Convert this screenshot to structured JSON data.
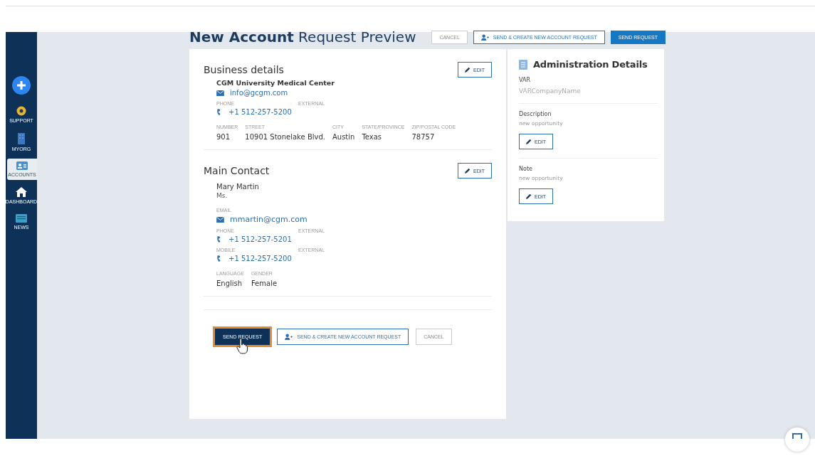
{
  "sidebar": {
    "items": [
      {
        "kind": "support",
        "label": "SUPPORT",
        "selected": false
      },
      {
        "kind": "org",
        "label": "MYORG",
        "selected": false
      },
      {
        "kind": "accounts",
        "label": "ACCOUNTS",
        "selected": true
      },
      {
        "kind": "home",
        "label": "DASHBOARD",
        "selected": false
      },
      {
        "kind": "news",
        "label": "NEWS",
        "selected": false
      }
    ]
  },
  "page": {
    "title_bold": "New Account",
    "title_rest": "Request Preview"
  },
  "top_actions": [
    {
      "kind": "plain",
      "label": "CANCEL"
    },
    {
      "kind": "outline",
      "label": "SEND & CREATE NEW ACCOUNT REQUEST"
    },
    {
      "kind": "primary",
      "label": "SEND REQUEST"
    }
  ],
  "business": {
    "heading": "Business details",
    "edit": "EDIT",
    "name": "CGM University Medical Center",
    "email": "info@gcgm.com",
    "phone_label": "PHONE",
    "external_label": "EXTERNAL",
    "phone": "+1 512-257-5200",
    "address": [
      {
        "label": "NUMBER",
        "value": "901"
      },
      {
        "label": "STREET",
        "value": "10901 Stonelake Blvd."
      },
      {
        "label": "CITY",
        "value": "Austin"
      },
      {
        "label": "STATE/PROVINCE",
        "value": "Texas"
      },
      {
        "label": "ZIP/POSTAL CODE",
        "value": "78757"
      }
    ]
  },
  "contact": {
    "heading": "Main Contact",
    "edit": "EDIT",
    "name": "Mary Martin",
    "salutation": "Ms.",
    "email_label": "EMAIL",
    "email": "mmartin@cgm.com",
    "phones": [
      {
        "label": "PHONE",
        "external_label": "EXTERNAL",
        "value": "+1 512-257-5201"
      },
      {
        "label": "MOBILE",
        "external_label": "EXTERNAL",
        "value": "+1 512-257-5200"
      }
    ],
    "extra": [
      {
        "label": "LANGUAGE",
        "value": "English"
      },
      {
        "label": "GENDER",
        "value": "Female"
      }
    ]
  },
  "bottom_actions": [
    {
      "kind": "primary",
      "label": "SEND REQUEST",
      "focused": true
    },
    {
      "kind": "outline",
      "label": "SEND & CREATE NEW ACCOUNT REQUEST",
      "focused": false
    },
    {
      "kind": "plain",
      "label": "CANCEL",
      "focused": false
    }
  ],
  "admin": {
    "heading": "Administration Details",
    "var_label": "VAR",
    "var_value": "VARCompanyName",
    "notes": [
      {
        "label": "Description",
        "value": "new opportunity",
        "edit": "EDIT"
      },
      {
        "label": "Note",
        "value": "new opportunity",
        "edit": "EDIT"
      }
    ]
  }
}
